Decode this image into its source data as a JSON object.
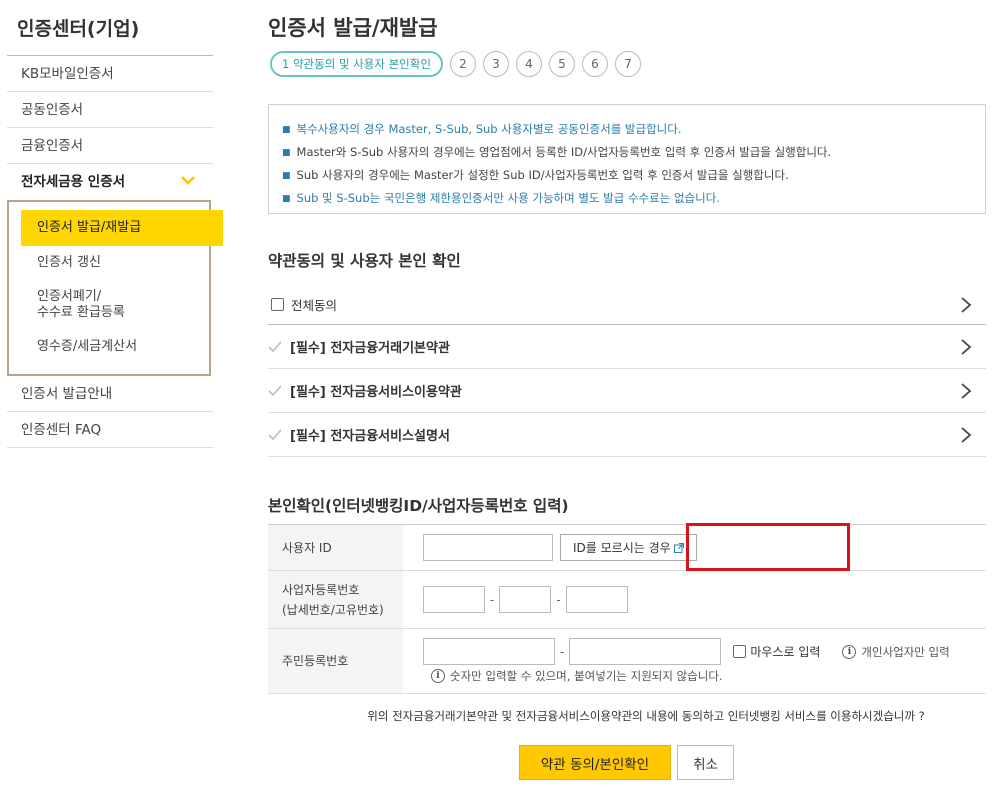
{
  "sidebar": {
    "title": "인증센터(기업)",
    "items": [
      {
        "label": "KB모바일인증서"
      },
      {
        "label": "공동인증서"
      },
      {
        "label": "금융인증서"
      },
      {
        "label": "전자세금용 인증서"
      }
    ],
    "submenu": [
      {
        "label": "인증서 발급/재발급"
      },
      {
        "label": "인증서 갱신"
      },
      {
        "label": "인증서폐기/\n수수료 환급등록"
      },
      {
        "label": "영수증/세금계산서"
      }
    ],
    "bottom_items": [
      {
        "label": "인증서 발급안내"
      },
      {
        "label": "인증센터 FAQ"
      }
    ]
  },
  "main": {
    "title": "인증서 발급/재발급",
    "steps": {
      "current": "1 약관동의 및 사용자 본인확인",
      "others": [
        "2",
        "3",
        "4",
        "5",
        "6",
        "7"
      ]
    },
    "notice": [
      "복수사용자의 경우 Master, S-Sub, Sub 사용자별로 공동인증서를 발급합니다.",
      "Master와 S-Sub 사용자의 경우에는 영업점에서 등록한 ID/사업자등록번호 입력 후 인증서 발급을 실행합니다.",
      "Sub 사용자의 경우에는 Master가 설정한 Sub ID/사업자등록번호 입력 후 인증서 발급을 실행합니다.",
      "Sub 및 S-Sub는 국민은행 제한용인증서만 사용 가능하며 별도 발급 수수료는 없습니다."
    ],
    "agree_section_title": "약관동의 및 사용자 본인 확인",
    "agree_all": "전체동의",
    "agree_items": [
      "[필수] 전자금융거래기본약관",
      "[필수] 전자금융서비스이용약관",
      "[필수] 전자금융서비스설명서"
    ],
    "verify_section_title": "본인확인(인터넷뱅킹ID/사업자등록번호 입력)",
    "form": {
      "user_id_label": "사용자 ID",
      "forgot_id_button": "ID를 모르시는 경우",
      "biz_no_label_1": "사업자등록번호",
      "biz_no_label_2": "(납세번호/고유번호)",
      "resident_label": "주민등록번호",
      "mouse_input_label": "마우스로 입력",
      "individual_note": "개인사업자만 입력",
      "digits_note": "숫자만 입력할 수 있으며, 붙여넣기는 지원되지 않습니다.",
      "dash": "-",
      "info_glyph": "i"
    },
    "confirm_question": "위의 전자금융거래기본약관 및 전자금융서비스이용약관의 내용에 동의하고 인터넷뱅킹 서비스를 이용하시겠습니까 ?",
    "confirm_button": "약관 동의/본인확인",
    "cancel_button": "취소"
  },
  "colors": {
    "accent_yellow": "#ffd600",
    "button_yellow": "#ffc800",
    "step_teal": "#2b9da5",
    "notice_blue": "#2b7dab",
    "highlight_red": "#d7141b"
  }
}
